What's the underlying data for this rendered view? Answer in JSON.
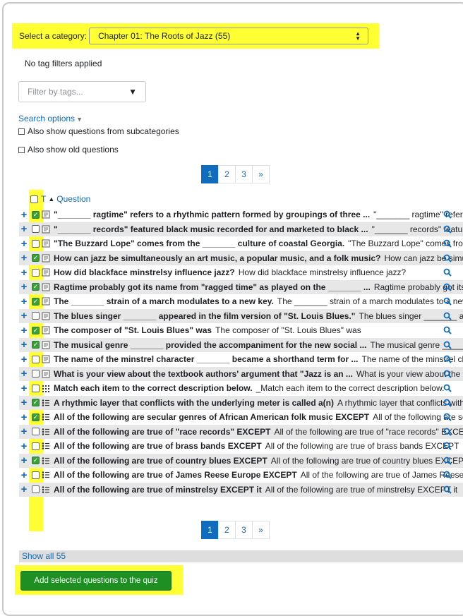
{
  "category": {
    "label": "Select a category:",
    "selected": "Chapter 01: The Roots of Jazz (55)"
  },
  "tags": {
    "status": "No tag filters applied",
    "placeholder": "Filter by tags..."
  },
  "search_options": {
    "label": "Search options",
    "subcategories": "Also show questions from subcategories",
    "old_questions": "Also show old questions"
  },
  "pagination": {
    "pages": [
      "1",
      "2",
      "3"
    ],
    "next": "»",
    "current": "1"
  },
  "table": {
    "type_header": "T",
    "question_header": "Question"
  },
  "questions": [
    {
      "title": "\"_______ ragtime\" refers to a rhythmic pattern formed by groupings of three ...",
      "preview": "\"_______ ragtime\" refers to a rhythmic pattern",
      "checked": true,
      "type": "essay"
    },
    {
      "title": "\"_______ records\" featured black music recorded for and marketed to black ...",
      "preview": "\"_______ records\" featured black music",
      "checked": false,
      "type": "essay"
    },
    {
      "title": "\"The Buzzard Lope\" comes from the _______ culture of coastal Georgia.",
      "preview": "\"The Buzzard Lope\" comes from the",
      "checked": false,
      "type": "essay"
    },
    {
      "title": "How can jazz be simultaneously an art music, a popular music, and a folk music?",
      "preview": "How can jazz be simultaneously",
      "checked": true,
      "type": "essay"
    },
    {
      "title": "How did blackface minstrelsy influence jazz?",
      "preview": "How did blackface minstrelsy influence jazz?",
      "checked": false,
      "type": "essay"
    },
    {
      "title": "Ragtime probably got its name from \"ragged time\" as played on the _______ ...",
      "preview": "Ragtime probably got its name",
      "checked": true,
      "type": "essay"
    },
    {
      "title": "The _______ strain of a march modulates to a new key.",
      "preview": "The _______ strain of a march modulates to a new key.",
      "checked": true,
      "type": "essay"
    },
    {
      "title": "The blues singer _______ appeared in the film version of \"St. Louis Blues.\"",
      "preview": "The blues singer _______ appeared",
      "checked": false,
      "type": "essay"
    },
    {
      "title": "The composer of \"St. Louis Blues\" was",
      "preview": "The composer of \"St. Louis Blues\" was",
      "checked": true,
      "type": "essay"
    },
    {
      "title": "The musical genre _______ provided the accompaniment for the new social ...",
      "preview": "The musical genre _______ provided",
      "checked": true,
      "type": "essay"
    },
    {
      "title": "The name of the minstrel character _______ became a shorthand term for ...",
      "preview": "The name of the minstrel character",
      "checked": false,
      "type": "essay"
    },
    {
      "title": "What is your view about the textbook authors' argument that \"Jazz is an ...",
      "preview": "What is your view about the textbook",
      "checked": false,
      "type": "essay"
    },
    {
      "title": "Match each item to the correct description below.",
      "preview": "_Match each item to the correct description below.",
      "checked": false,
      "type": "match"
    },
    {
      "title": "A rhythmic layer that conflicts with the underlying meter is called a(n)",
      "preview": "A rhythmic layer that conflicts with the underlying meter",
      "checked": true,
      "type": "multichoice"
    },
    {
      "title": "All of the following are secular genres of African American folk music EXCEPT",
      "preview": "All of the following are secular genres",
      "checked": true,
      "type": "multichoice"
    },
    {
      "title": "All of the following are true of \"race records\" EXCEPT",
      "preview": "All of the following are true of \"race records\" EXCEPT",
      "checked": false,
      "type": "multichoice"
    },
    {
      "title": "All of the following are true of brass bands EXCEPT",
      "preview": "All of the following are true of brass bands EXCEPT",
      "checked": false,
      "type": "multichoice"
    },
    {
      "title": "All of the following are true of country blues EXCEPT",
      "preview": "All of the following are true of country blues EXCEPT",
      "checked": true,
      "type": "multichoice"
    },
    {
      "title": "All of the following are true of James Reese Europe EXCEPT",
      "preview": "All of the following are true of James Reese Europe EXCEPT",
      "checked": false,
      "type": "multichoice"
    },
    {
      "title": "All of the following are true of minstrelsy EXCEPT it",
      "preview": "All of the following are true of minstrelsy EXCEPT it",
      "checked": false,
      "type": "multichoice"
    }
  ],
  "show_all": "Show all 55",
  "add_button": "Add selected questions to the quiz",
  "colors": {
    "link": "#0f6cbf",
    "highlight": "#ffff33",
    "button": "#1e8f23",
    "check": "#3aa03a"
  }
}
